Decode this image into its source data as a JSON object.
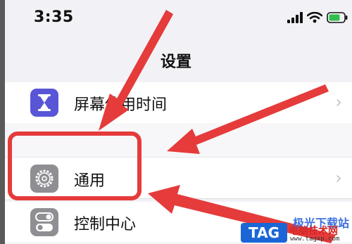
{
  "status_bar": {
    "time": "3:35",
    "icons": [
      "signal-icon",
      "wifi-icon",
      "battery-icon"
    ]
  },
  "nav": {
    "title": "设置"
  },
  "settings_rows": [
    {
      "label": "屏幕使用时间",
      "icon": "hourglass-icon",
      "icon_color": "#5856d6"
    },
    {
      "label": "",
      "icon": "",
      "icon_color": ""
    },
    {
      "label": "通用",
      "icon": "gear-icon",
      "icon_color": "#8e8e93"
    },
    {
      "label": "控制中心",
      "icon": "toggles-icon",
      "icon_color": "#8e8e93"
    }
  ],
  "annotation": {
    "highlight_color": "#e53b3b",
    "arrow_color": "#e53b3b"
  },
  "watermark": {
    "site_name": "极光下载站",
    "tag": "TAG",
    "cn_text": "电脑技术网",
    "url": "www.tagxp.com"
  },
  "colors": {
    "background": "#f2f2f6",
    "row_background": "#ffffff",
    "accent": "#1b66d6"
  }
}
